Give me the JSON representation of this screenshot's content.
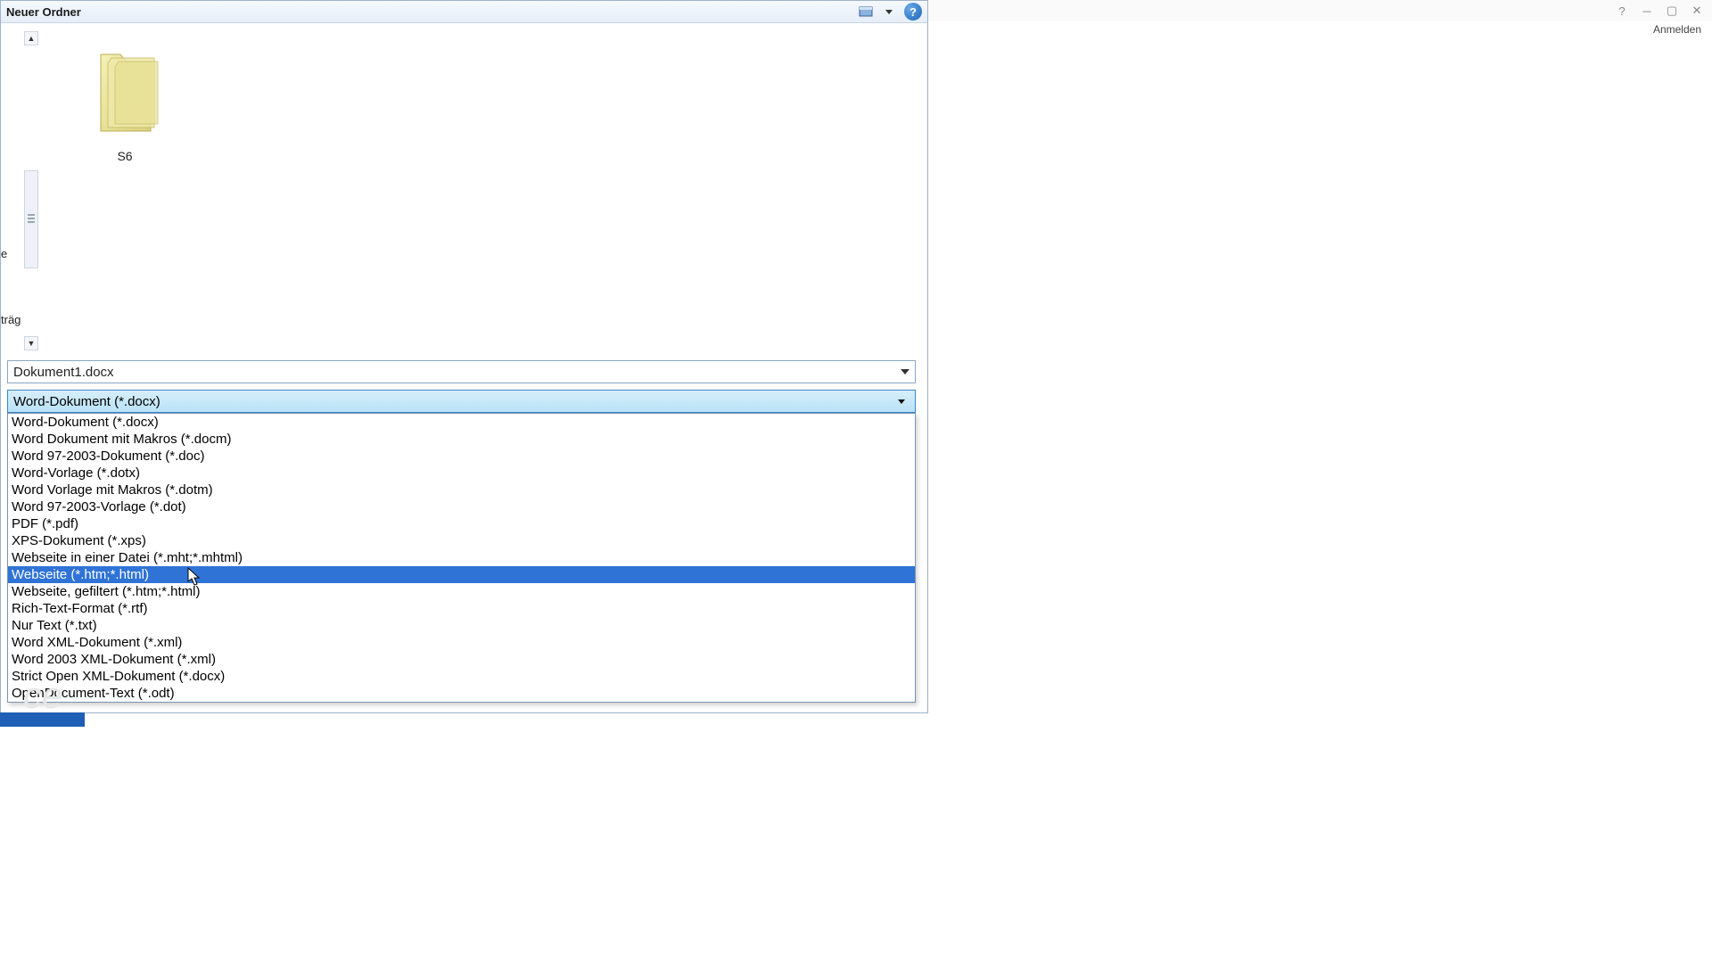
{
  "window": {
    "title": "Neuer Ordner"
  },
  "folder": {
    "label": "S6"
  },
  "crumb_fragment_top": "e",
  "crumb_fragment": "träg",
  "filename": {
    "value": "Dokument1.docx"
  },
  "filetype": {
    "selected": "Word-Dokument (*.docx)",
    "highlighted_index": 9,
    "options": [
      "Word-Dokument (*.docx)",
      "Word Dokument mit Makros (*.docm)",
      "Word 97-2003-Dokument (*.doc)",
      "Word-Vorlage (*.dotx)",
      "Word Vorlage mit Makros (*.dotm)",
      "Word 97-2003-Vorlage (*.dot)",
      "PDF (*.pdf)",
      "XPS-Dokument (*.xps)",
      "Webseite in einer Datei (*.mht;*.mhtml)",
      "Webseite (*.htm;*.html)",
      "Webseite, gefiltert (*.htm;*.html)",
      "Rich-Text-Format (*.rtf)",
      "Nur Text (*.txt)",
      "Word XML-Dokument (*.xml)",
      "Word 2003 XML-Dokument (*.xml)",
      "Strict Open XML-Dokument (*.docx)",
      "OpenDocument-Text (*.odt)"
    ]
  },
  "parent": {
    "signin": "Anmelden"
  },
  "icons": {
    "monitor": "monitor-icon",
    "help": "?"
  }
}
